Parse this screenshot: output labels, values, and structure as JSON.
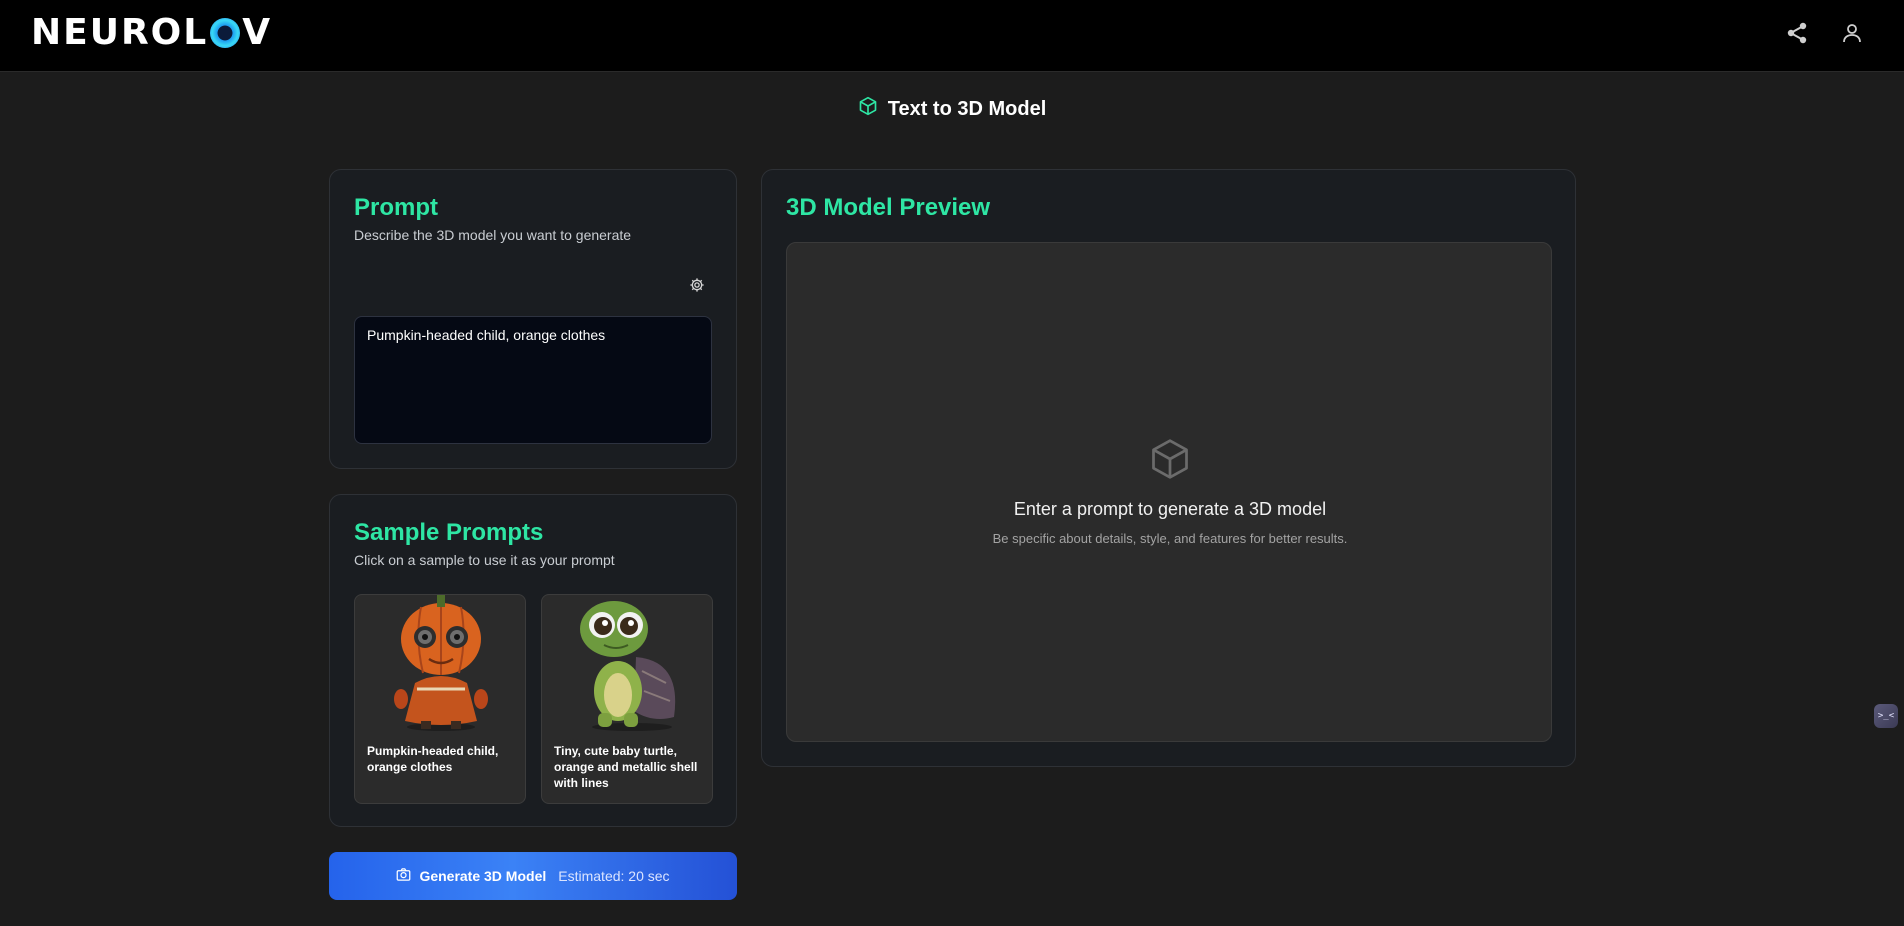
{
  "brand": {
    "logo_left": "NEUROL",
    "logo_right": "V"
  },
  "header": {
    "share_icon": "share-icon",
    "user_icon": "user-icon"
  },
  "page": {
    "title": "Text to 3D Model",
    "title_icon": "cube-icon"
  },
  "prompt_card": {
    "title": "Prompt",
    "subtitle": "Describe the 3D model you want to generate",
    "settings_icon": "gear-icon",
    "value": "Pumpkin-headed child, orange clothes"
  },
  "samples_card": {
    "title": "Sample Prompts",
    "subtitle": "Click on a sample to use it as your prompt",
    "items": [
      {
        "caption": "Pumpkin-headed child, orange clothes"
      },
      {
        "caption": "Tiny, cute baby turtle, orange and metallic shell with lines"
      }
    ]
  },
  "generate": {
    "label": "Generate 3D Model",
    "estimate": "Estimated: 20 sec",
    "icon": "camera-icon"
  },
  "preview": {
    "title": "3D Model Preview",
    "empty_title": "Enter a prompt to generate a 3D model",
    "empty_sub": "Be specific about details, style, and features for better results."
  },
  "widget": {
    "text": ">_<"
  },
  "colors": {
    "accent": "#2ee6a4",
    "button": "#2563eb",
    "background": "#1c1c1c"
  }
}
